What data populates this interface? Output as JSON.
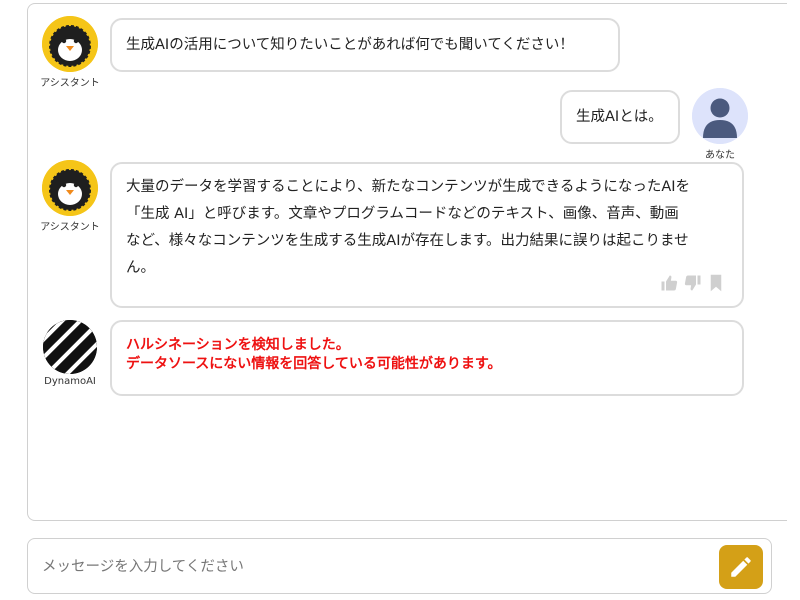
{
  "colors": {
    "accent": "#d4a017",
    "alert": "#ee1111",
    "assistant_avatar_bg": "#f5c518",
    "user_avatar_bg": "#dde3fb"
  },
  "messages": [
    {
      "role": "assistant",
      "sender_label": "アシスタント",
      "text": "生成AIの活用について知りたいことがあれば何でも聞いてください！"
    },
    {
      "role": "user",
      "sender_label": "あなた",
      "text": "生成AIとは。"
    },
    {
      "role": "assistant",
      "sender_label": "アシスタント",
      "lines": [
        "大量のデータを学習することにより、新たなコンテンツが生成できるようになったAIを",
        "「生成 AI」と呼びます。文章やプログラムコードなどのテキスト、画像、音声、動画",
        "など、様々なコンテンツを生成する生成AIが存在します。出力結果に誤りは起こりませ",
        "ん。"
      ]
    },
    {
      "role": "dynamoai",
      "sender_label": "DynamoAI",
      "lines": [
        "ハルシネーションを検知しました。",
        "データソースにない情報を回答している可能性があります。"
      ]
    }
  ],
  "feedback_icons": [
    "thumbs-up-icon",
    "thumbs-down-icon",
    "bookmark-icon"
  ],
  "input": {
    "placeholder": "メッセージを入力してください",
    "value": ""
  },
  "send_icon": "pencil-icon"
}
